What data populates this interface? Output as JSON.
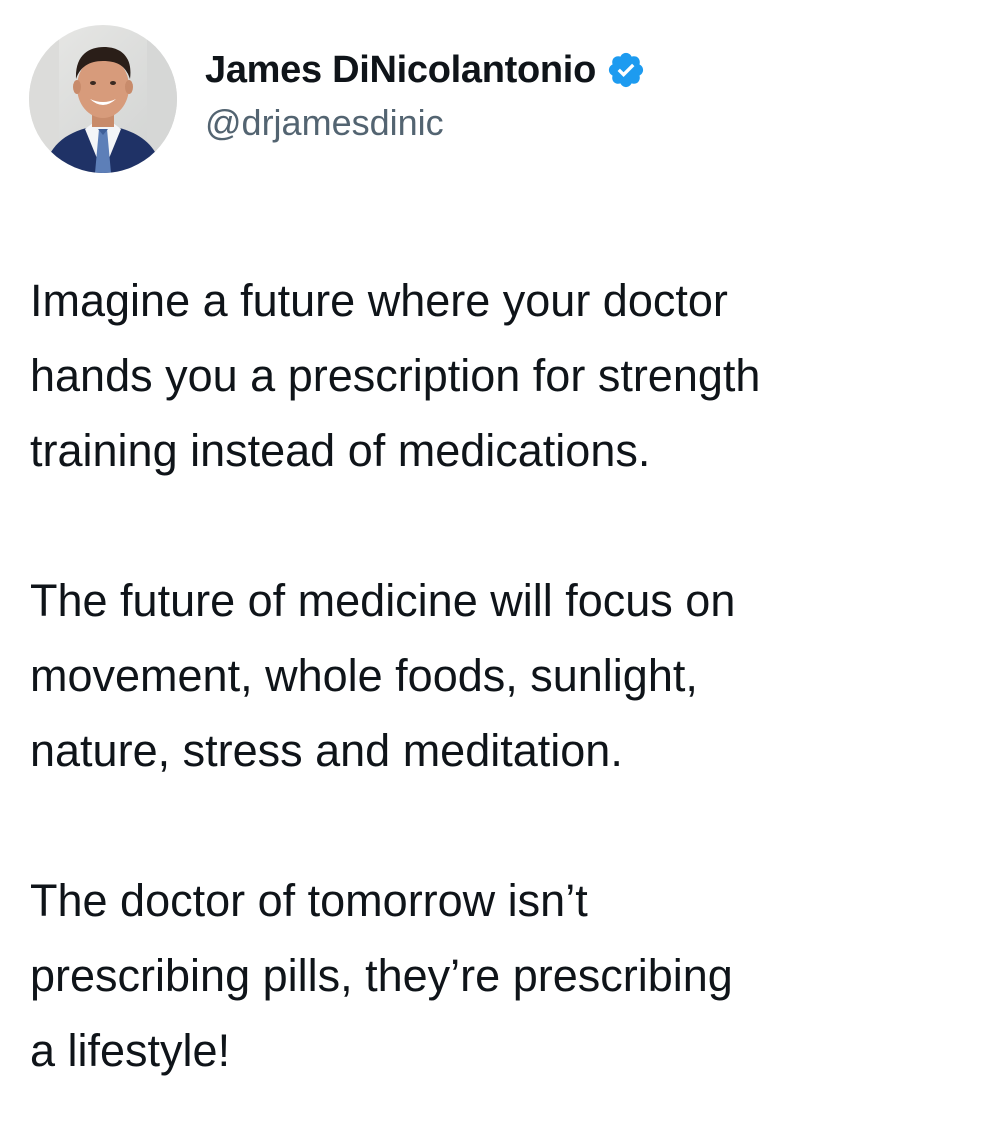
{
  "author": {
    "display_name": "James DiNicolantonio",
    "handle": "@drjamesdinic",
    "verified": true,
    "verified_color": "#1d9bf0",
    "avatar_icon": "profile-photo"
  },
  "tweet": {
    "paragraphs": [
      {
        "lines": [
          "Imagine a future where your doctor",
          "hands you a prescription for strength",
          "training instead of medications."
        ]
      },
      {
        "lines": [
          "The future of medicine will focus on",
          "movement, whole foods, sunlight,",
          "nature, stress and meditation."
        ]
      },
      {
        "lines": [
          "The doctor of tomorrow isn’t",
          "prescribing pills, they’re prescribing",
          "a lifestyle!"
        ]
      }
    ]
  }
}
